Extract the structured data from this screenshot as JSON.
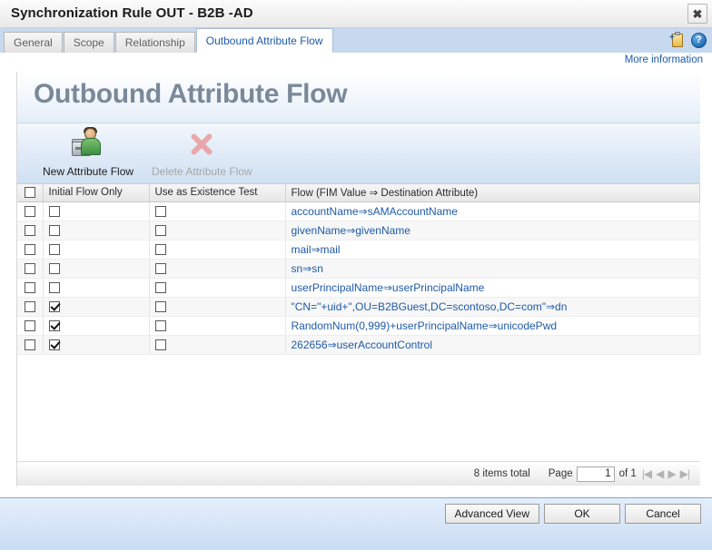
{
  "window": {
    "title": "Synchronization Rule OUT - B2B -AD",
    "close_label": "✖"
  },
  "tabs": [
    {
      "label": "General",
      "active": false
    },
    {
      "label": "Scope",
      "active": false
    },
    {
      "label": "Relationship",
      "active": false
    },
    {
      "label": "Outbound Attribute Flow",
      "active": true
    }
  ],
  "tabstrip_icons": [
    {
      "name": "add-clipboard-icon",
      "glyph": "+"
    },
    {
      "name": "help-icon",
      "glyph": "?"
    }
  ],
  "links": {
    "more_information": "More information"
  },
  "banner": {
    "title": "Outbound Attribute Flow"
  },
  "toolbar": {
    "new_flow_label": "New Attribute Flow",
    "delete_flow_label": "Delete Attribute Flow"
  },
  "grid": {
    "columns": [
      "",
      "Initial Flow Only",
      "Use as Existence Test",
      "Flow (FIM Value ⇒ Destination Attribute)"
    ],
    "rows": [
      {
        "selected": false,
        "initial_flow_only": false,
        "use_as_existence_test": false,
        "flow": "accountName⇒sAMAccountName"
      },
      {
        "selected": false,
        "initial_flow_only": false,
        "use_as_existence_test": false,
        "flow": "givenName⇒givenName"
      },
      {
        "selected": false,
        "initial_flow_only": false,
        "use_as_existence_test": false,
        "flow": "mail⇒mail"
      },
      {
        "selected": false,
        "initial_flow_only": false,
        "use_as_existence_test": false,
        "flow": "sn⇒sn"
      },
      {
        "selected": false,
        "initial_flow_only": false,
        "use_as_existence_test": false,
        "flow": "userPrincipalName⇒userPrincipalName"
      },
      {
        "selected": false,
        "initial_flow_only": true,
        "use_as_existence_test": false,
        "flow": "\"CN=\"+uid+\",OU=B2BGuest,DC=scontoso,DC=com\"⇒dn"
      },
      {
        "selected": false,
        "initial_flow_only": true,
        "use_as_existence_test": false,
        "flow": "RandomNum(0,999)+userPrincipalName⇒unicodePwd"
      },
      {
        "selected": false,
        "initial_flow_only": true,
        "use_as_existence_test": false,
        "flow": "262656⇒userAccountControl"
      }
    ]
  },
  "pager": {
    "items_total": "8 items total",
    "page_label": "Page",
    "page_value": "1",
    "of_label": "of 1",
    "nav_first": "⏮",
    "nav_prev": "◀",
    "nav_next": "▶",
    "nav_last": "⏭"
  },
  "footer": {
    "advanced_view": "Advanced View",
    "ok": "OK",
    "cancel": "Cancel"
  },
  "colors": {
    "link": "#1e5aa8",
    "tabstrip": "#c6d9ef",
    "banner_title": "#7a8999",
    "footer": "#c8dcf2"
  }
}
